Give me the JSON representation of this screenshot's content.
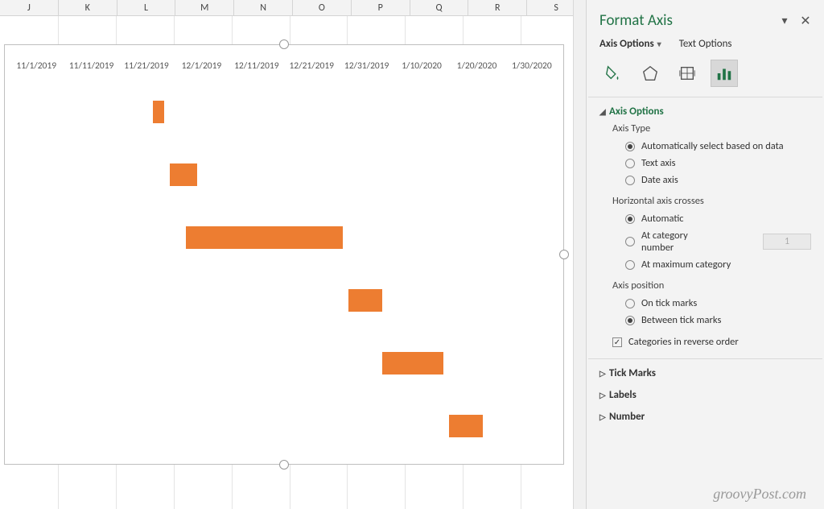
{
  "columns": [
    "J",
    "K",
    "L",
    "M",
    "N",
    "O",
    "P",
    "Q",
    "R",
    "S"
  ],
  "dates": [
    "11/1/2019",
    "11/11/2019",
    "11/21/2019",
    "12/1/2019",
    "12/11/2019",
    "12/21/2019",
    "12/31/2019",
    "1/10/2020",
    "1/20/2020",
    "1/30/2020"
  ],
  "chart_data": {
    "type": "bar",
    "orientation": "horizontal",
    "x_axis": {
      "type": "date",
      "tick_labels": [
        "11/1/2019",
        "11/11/2019",
        "11/21/2019",
        "12/1/2019",
        "12/11/2019",
        "12/21/2019",
        "12/31/2019",
        "1/10/2020",
        "1/20/2020",
        "1/30/2020"
      ]
    },
    "bars": [
      {
        "start": "11/24/2019",
        "end": "11/26/2019"
      },
      {
        "start": "11/27/2019",
        "end": "12/2/2019"
      },
      {
        "start": "11/30/2019",
        "end": "12/28/2019"
      },
      {
        "start": "12/29/2019",
        "end": "1/4/2020"
      },
      {
        "start": "1/4/2020",
        "end": "1/15/2020"
      },
      {
        "start": "1/16/2020",
        "end": "1/22/2020"
      }
    ],
    "bar_color": "#ed7d31"
  },
  "pane": {
    "title": "Format Axis",
    "tabs": {
      "axis_options": "Axis Options",
      "text_options": "Text Options"
    },
    "section_axis_options": "Axis Options",
    "axis_type": {
      "label": "Axis Type",
      "auto": "Automatically select based on data",
      "text": "Text axis",
      "date": "Date axis",
      "selected": "auto"
    },
    "h_crosses": {
      "label": "Horizontal axis crosses",
      "auto": "Automatic",
      "at_cat": "At category number",
      "at_cat_value": "1",
      "at_max": "At maximum category",
      "selected": "auto"
    },
    "axis_position": {
      "label": "Axis position",
      "on": "On tick marks",
      "between": "Between tick marks",
      "selected": "between"
    },
    "reverse": {
      "label": "Categories in reverse order",
      "checked": true
    },
    "collapsed": {
      "tick_marks": "Tick Marks",
      "labels": "Labels",
      "number": "Number"
    }
  },
  "watermark": "groovyPost.com"
}
